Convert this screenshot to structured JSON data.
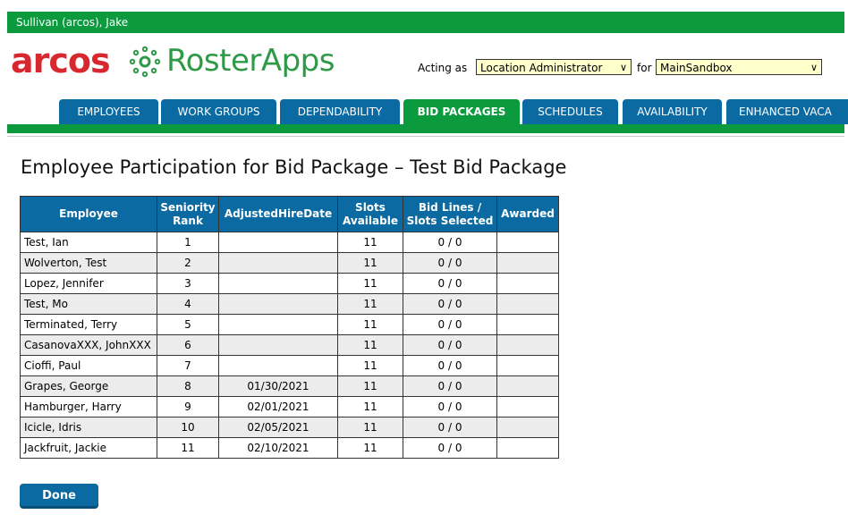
{
  "user": {
    "name": "Sullivan (arcos), Jake"
  },
  "brand": {
    "logo_left": "arcos",
    "logo_right": "RosterApps",
    "red": "#d8282f",
    "green": "#2e9a47"
  },
  "context": {
    "acting_label": "Acting as",
    "role_value": "Location Administrator",
    "for_label": "for",
    "location_value": "MainSandbox"
  },
  "tabs": [
    {
      "label": "EMPLOYEES",
      "active": false
    },
    {
      "label": "WORK GROUPS",
      "active": false
    },
    {
      "label": "DEPENDABILITY",
      "active": false
    },
    {
      "label": "BID PACKAGES",
      "active": true
    },
    {
      "label": "SCHEDULES",
      "active": false
    },
    {
      "label": "AVAILABILITY",
      "active": false
    },
    {
      "label": "ENHANCED VACA",
      "active": false
    }
  ],
  "page": {
    "title": "Employee Participation for Bid Package – Test Bid Package"
  },
  "table": {
    "headers": {
      "employee": "Employee",
      "seniority_l1": "Seniority",
      "seniority_l2": "Rank",
      "hire": "AdjustedHireDate",
      "slots_l1": "Slots",
      "slots_l2": "Available",
      "bid_l1": "Bid Lines /",
      "bid_l2": "Slots Selected",
      "awarded": "Awarded"
    },
    "rows": [
      {
        "employee": "Test, Ian",
        "rank": "1",
        "hire": "",
        "slots": "11",
        "bid": "0 / 0",
        "awarded": ""
      },
      {
        "employee": "Wolverton, Test",
        "rank": "2",
        "hire": "",
        "slots": "11",
        "bid": "0 / 0",
        "awarded": ""
      },
      {
        "employee": "Lopez, Jennifer",
        "rank": "3",
        "hire": "",
        "slots": "11",
        "bid": "0 / 0",
        "awarded": ""
      },
      {
        "employee": "Test, Mo",
        "rank": "4",
        "hire": "",
        "slots": "11",
        "bid": "0 / 0",
        "awarded": ""
      },
      {
        "employee": "Terminated, Terry",
        "rank": "5",
        "hire": "",
        "slots": "11",
        "bid": "0 / 0",
        "awarded": ""
      },
      {
        "employee": "CasanovaXXX, JohnXXX",
        "rank": "6",
        "hire": "",
        "slots": "11",
        "bid": "0 / 0",
        "awarded": ""
      },
      {
        "employee": "Cioffi, Paul",
        "rank": "7",
        "hire": "",
        "slots": "11",
        "bid": "0 / 0",
        "awarded": ""
      },
      {
        "employee": "Grapes, George",
        "rank": "8",
        "hire": "01/30/2021",
        "slots": "11",
        "bid": "0 / 0",
        "awarded": ""
      },
      {
        "employee": "Hamburger, Harry",
        "rank": "9",
        "hire": "02/01/2021",
        "slots": "11",
        "bid": "0 / 0",
        "awarded": ""
      },
      {
        "employee": "Icicle, Idris",
        "rank": "10",
        "hire": "02/05/2021",
        "slots": "11",
        "bid": "0 / 0",
        "awarded": ""
      },
      {
        "employee": "Jackfruit, Jackie",
        "rank": "11",
        "hire": "02/10/2021",
        "slots": "11",
        "bid": "0 / 0",
        "awarded": ""
      }
    ]
  },
  "actions": {
    "done_label": "Done"
  }
}
